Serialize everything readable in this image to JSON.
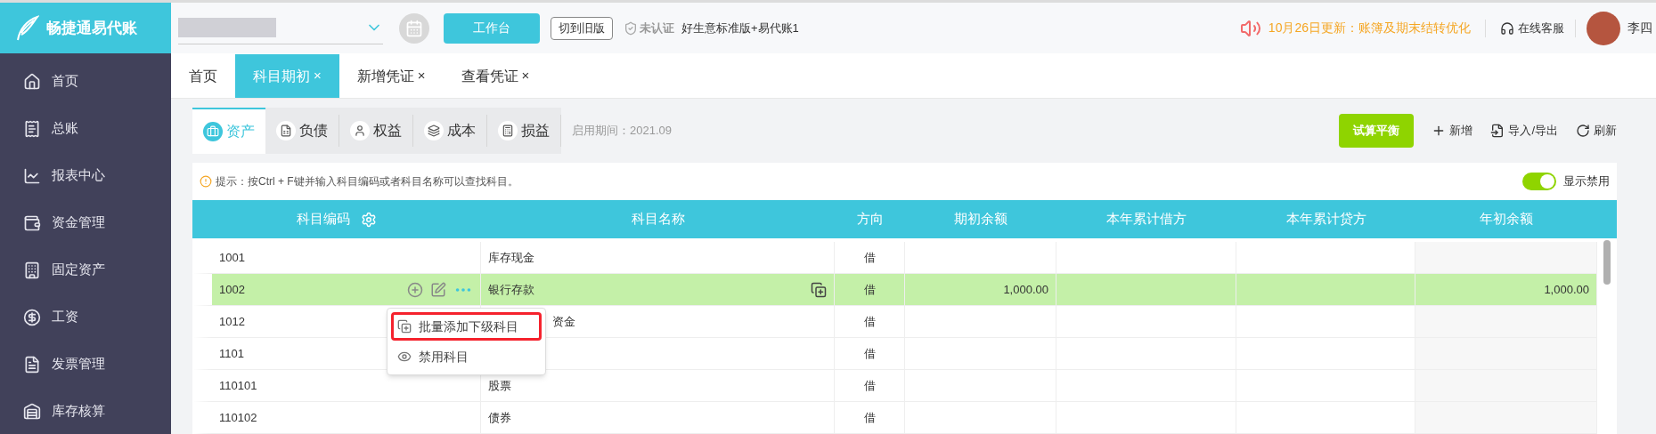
{
  "header": {
    "logo_text": "畅捷通易代账",
    "workbench_button": "工作台",
    "old_version_button": "切到旧版",
    "certification": "未认证",
    "edition": "好生意标准版+易代账1",
    "update_notice": "10月26日更新：账簿及期末结转优化",
    "support": "在线客服",
    "user_name": "李四"
  },
  "sidebar": {
    "items": [
      {
        "label": "首页"
      },
      {
        "label": "总账"
      },
      {
        "label": "报表中心"
      },
      {
        "label": "资金管理"
      },
      {
        "label": "固定资产"
      },
      {
        "label": "工资"
      },
      {
        "label": "发票管理"
      },
      {
        "label": "库存核算"
      }
    ]
  },
  "tabs": [
    {
      "label": "首页",
      "selected": false
    },
    {
      "label": "科目期初",
      "selected": true,
      "close": "×"
    },
    {
      "label": "新增凭证",
      "selected": false,
      "close": "×"
    },
    {
      "label": "查看凭证",
      "selected": false,
      "close": "×"
    }
  ],
  "category_tabs": [
    {
      "label": "资产",
      "selected": true
    },
    {
      "label": "负债",
      "selected": false
    },
    {
      "label": "权益",
      "selected": false
    },
    {
      "label": "成本",
      "selected": false
    },
    {
      "label": "损益",
      "selected": false
    }
  ],
  "start_period": "启用期间：2021.09",
  "toolbar": {
    "trial_balance": "试算平衡",
    "add": "新增",
    "import_export": "导入/导出",
    "refresh": "刷新"
  },
  "hint": "提示：按Ctrl + F键并输入科目编码或者科目名称可以查找科目。",
  "show_disabled": {
    "label": "显示禁用",
    "on": true
  },
  "table": {
    "columns": [
      "科目编码",
      "科目名称",
      "方向",
      "期初余额",
      "本年累计借方",
      "本年累计贷方",
      "年初余额"
    ],
    "rows": [
      {
        "code": "1001",
        "name": "库存现金",
        "direction": "借",
        "selected": false
      },
      {
        "code": "1002",
        "name": "银行存款",
        "direction": "借",
        "opening": "1,000.00",
        "year_start": "1,000.00",
        "selected": true
      },
      {
        "code": "1012",
        "name": "资金",
        "direction": "借",
        "selected": false
      },
      {
        "code": "1101",
        "direction": "借",
        "selected": false
      },
      {
        "code": "110101",
        "name": "股票",
        "direction": "借",
        "selected": false
      },
      {
        "code": "110102",
        "name": "债券",
        "direction": "借",
        "selected": false
      }
    ]
  },
  "row_menu": {
    "items": [
      {
        "label": "批量添加下级科目",
        "highlighted": true
      },
      {
        "label": "禁用科目",
        "highlighted": false
      }
    ]
  }
}
